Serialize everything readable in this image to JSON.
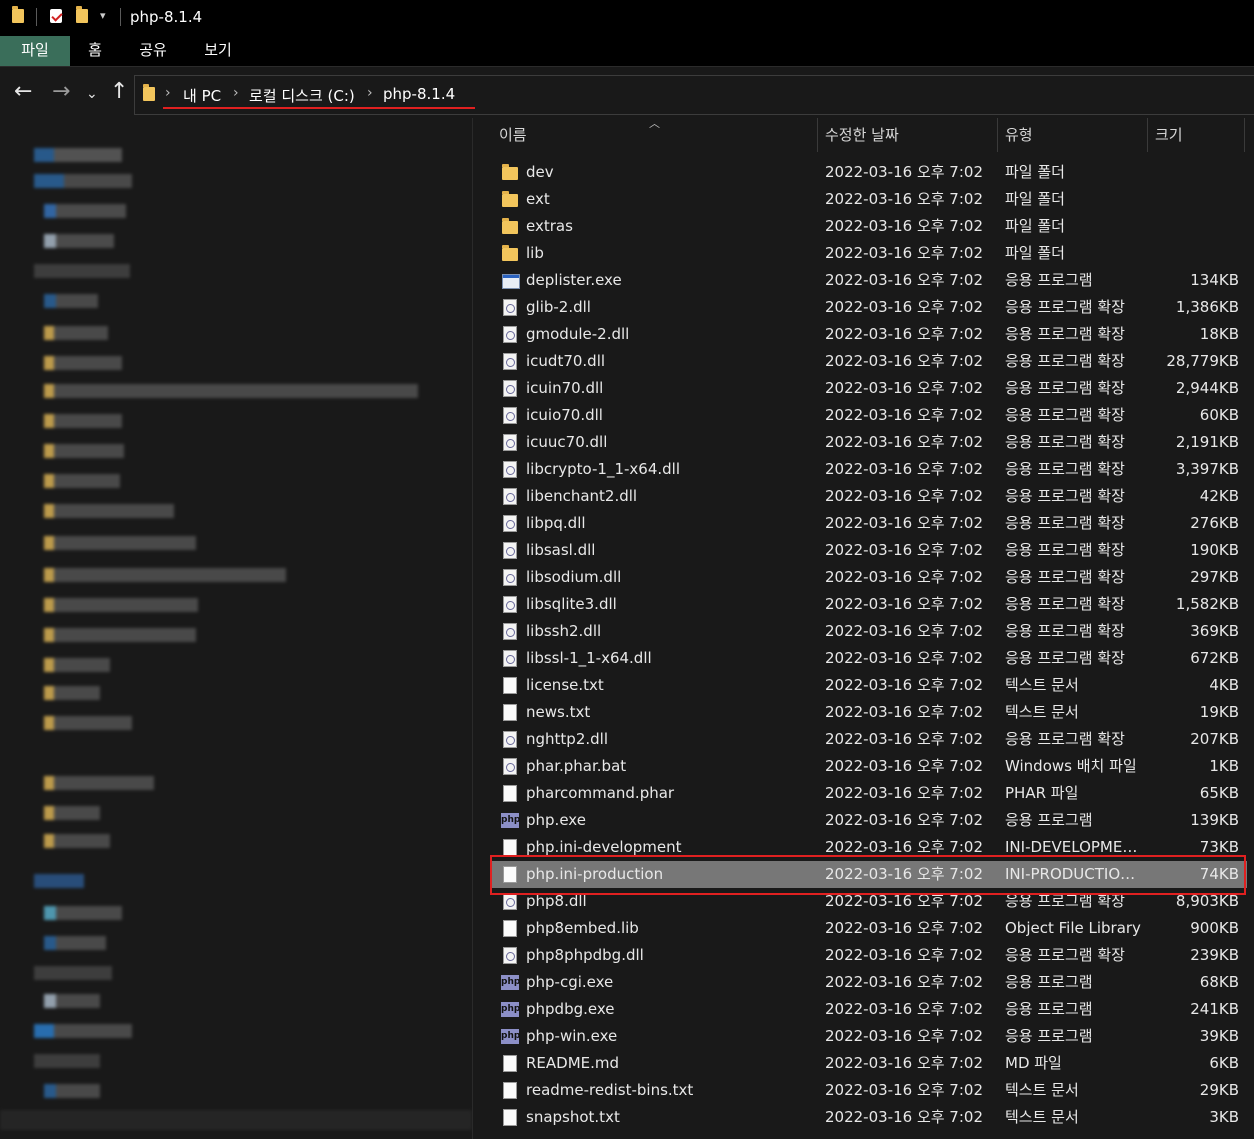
{
  "window": {
    "title": "php-8.1.4"
  },
  "ribbon": {
    "tabs": [
      "파일",
      "홈",
      "공유",
      "보기"
    ]
  },
  "address": {
    "crumbs": [
      "내 PC",
      "로컬 디스크 (C:)",
      "php-8.1.4"
    ]
  },
  "columns": {
    "name": "이름",
    "date": "수정한 날짜",
    "type": "유형",
    "size": "크기"
  },
  "files": [
    {
      "name": "dev",
      "date": "2022-03-16 오후 7:02",
      "type": "파일 폴더",
      "size": "",
      "icon": "folder"
    },
    {
      "name": "ext",
      "date": "2022-03-16 오후 7:02",
      "type": "파일 폴더",
      "size": "",
      "icon": "folder"
    },
    {
      "name": "extras",
      "date": "2022-03-16 오후 7:02",
      "type": "파일 폴더",
      "size": "",
      "icon": "folder"
    },
    {
      "name": "lib",
      "date": "2022-03-16 오후 7:02",
      "type": "파일 폴더",
      "size": "",
      "icon": "folder"
    },
    {
      "name": "deplister.exe",
      "date": "2022-03-16 오후 7:02",
      "type": "응용 프로그램",
      "size": "134KB",
      "icon": "exe"
    },
    {
      "name": "glib-2.dll",
      "date": "2022-03-16 오후 7:02",
      "type": "응용 프로그램 확장",
      "size": "1,386KB",
      "icon": "dll"
    },
    {
      "name": "gmodule-2.dll",
      "date": "2022-03-16 오후 7:02",
      "type": "응용 프로그램 확장",
      "size": "18KB",
      "icon": "dll"
    },
    {
      "name": "icudt70.dll",
      "date": "2022-03-16 오후 7:02",
      "type": "응용 프로그램 확장",
      "size": "28,779KB",
      "icon": "dll"
    },
    {
      "name": "icuin70.dll",
      "date": "2022-03-16 오후 7:02",
      "type": "응용 프로그램 확장",
      "size": "2,944KB",
      "icon": "dll"
    },
    {
      "name": "icuio70.dll",
      "date": "2022-03-16 오후 7:02",
      "type": "응용 프로그램 확장",
      "size": "60KB",
      "icon": "dll"
    },
    {
      "name": "icuuc70.dll",
      "date": "2022-03-16 오후 7:02",
      "type": "응용 프로그램 확장",
      "size": "2,191KB",
      "icon": "dll"
    },
    {
      "name": "libcrypto-1_1-x64.dll",
      "date": "2022-03-16 오후 7:02",
      "type": "응용 프로그램 확장",
      "size": "3,397KB",
      "icon": "dll"
    },
    {
      "name": "libenchant2.dll",
      "date": "2022-03-16 오후 7:02",
      "type": "응용 프로그램 확장",
      "size": "42KB",
      "icon": "dll"
    },
    {
      "name": "libpq.dll",
      "date": "2022-03-16 오후 7:02",
      "type": "응용 프로그램 확장",
      "size": "276KB",
      "icon": "dll"
    },
    {
      "name": "libsasl.dll",
      "date": "2022-03-16 오후 7:02",
      "type": "응용 프로그램 확장",
      "size": "190KB",
      "icon": "dll"
    },
    {
      "name": "libsodium.dll",
      "date": "2022-03-16 오후 7:02",
      "type": "응용 프로그램 확장",
      "size": "297KB",
      "icon": "dll"
    },
    {
      "name": "libsqlite3.dll",
      "date": "2022-03-16 오후 7:02",
      "type": "응용 프로그램 확장",
      "size": "1,582KB",
      "icon": "dll"
    },
    {
      "name": "libssh2.dll",
      "date": "2022-03-16 오후 7:02",
      "type": "응용 프로그램 확장",
      "size": "369KB",
      "icon": "dll"
    },
    {
      "name": "libssl-1_1-x64.dll",
      "date": "2022-03-16 오후 7:02",
      "type": "응용 프로그램 확장",
      "size": "672KB",
      "icon": "dll"
    },
    {
      "name": "license.txt",
      "date": "2022-03-16 오후 7:02",
      "type": "텍스트 문서",
      "size": "4KB",
      "icon": "doc"
    },
    {
      "name": "news.txt",
      "date": "2022-03-16 오후 7:02",
      "type": "텍스트 문서",
      "size": "19KB",
      "icon": "doc"
    },
    {
      "name": "nghttp2.dll",
      "date": "2022-03-16 오후 7:02",
      "type": "응용 프로그램 확장",
      "size": "207KB",
      "icon": "dll"
    },
    {
      "name": "phar.phar.bat",
      "date": "2022-03-16 오후 7:02",
      "type": "Windows 배치 파일",
      "size": "1KB",
      "icon": "dll"
    },
    {
      "name": "pharcommand.phar",
      "date": "2022-03-16 오후 7:02",
      "type": "PHAR 파일",
      "size": "65KB",
      "icon": "doc"
    },
    {
      "name": "php.exe",
      "date": "2022-03-16 오후 7:02",
      "type": "응용 프로그램",
      "size": "139KB",
      "icon": "php"
    },
    {
      "name": "php.ini-development",
      "date": "2022-03-16 오후 7:02",
      "type": "INI-DEVELOPMEN...",
      "size": "73KB",
      "icon": "doc"
    },
    {
      "name": "php.ini-production",
      "date": "2022-03-16 오후 7:02",
      "type": "INI-PRODUCTION...",
      "size": "74KB",
      "icon": "doc",
      "selected": true
    },
    {
      "name": "php8.dll",
      "date": "2022-03-16 오후 7:02",
      "type": "응용 프로그램 확장",
      "size": "8,903KB",
      "icon": "dll"
    },
    {
      "name": "php8embed.lib",
      "date": "2022-03-16 오후 7:02",
      "type": "Object File Library",
      "size": "900KB",
      "icon": "doc"
    },
    {
      "name": "php8phpdbg.dll",
      "date": "2022-03-16 오후 7:02",
      "type": "응용 프로그램 확장",
      "size": "239KB",
      "icon": "dll"
    },
    {
      "name": "php-cgi.exe",
      "date": "2022-03-16 오후 7:02",
      "type": "응용 프로그램",
      "size": "68KB",
      "icon": "php"
    },
    {
      "name": "phpdbg.exe",
      "date": "2022-03-16 오후 7:02",
      "type": "응용 프로그램",
      "size": "241KB",
      "icon": "php"
    },
    {
      "name": "php-win.exe",
      "date": "2022-03-16 오후 7:02",
      "type": "응용 프로그램",
      "size": "39KB",
      "icon": "php"
    },
    {
      "name": "README.md",
      "date": "2022-03-16 오후 7:02",
      "type": "MD 파일",
      "size": "6KB",
      "icon": "doc"
    },
    {
      "name": "readme-redist-bins.txt",
      "date": "2022-03-16 오후 7:02",
      "type": "텍스트 문서",
      "size": "29KB",
      "icon": "doc"
    },
    {
      "name": "snapshot.txt",
      "date": "2022-03-16 오후 7:02",
      "type": "텍스트 문서",
      "size": "3KB",
      "icon": "doc"
    }
  ],
  "icon_label": "php",
  "colors": {
    "accent_file_tab": "#3a6e5a",
    "selection": "#777777",
    "highlight": "#e02020",
    "folder": "#f2c55c"
  }
}
